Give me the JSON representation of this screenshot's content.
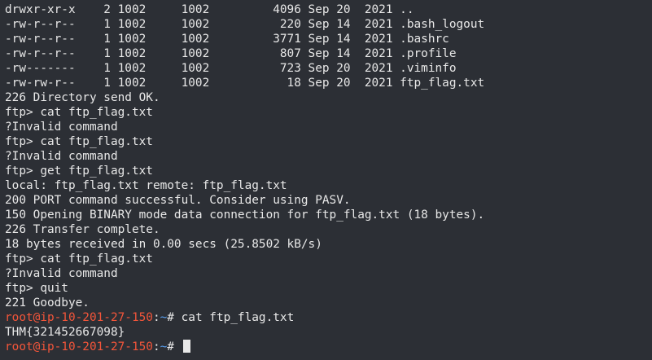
{
  "terminal": {
    "listing": [
      "drwxr-xr-x    2 1002     1002         4096 Sep 20  2021 ..",
      "-rw-r--r--    1 1002     1002          220 Sep 14  2021 .bash_logout",
      "-rw-r--r--    1 1002     1002         3771 Sep 14  2021 .bashrc",
      "-rw-r--r--    1 1002     1002          807 Sep 14  2021 .profile",
      "-rw-------    1 1002     1002          723 Sep 20  2021 .viminfo",
      "-rw-rw-r--    1 1002     1002           18 Sep 20  2021 ftp_flag.txt"
    ],
    "output": [
      "226 Directory send OK.",
      "ftp> cat ftp_flag.txt",
      "?Invalid command",
      "ftp> cat ftp_flag.txt",
      "?Invalid command",
      "ftp> get ftp_flag.txt",
      "local: ftp_flag.txt remote: ftp_flag.txt",
      "200 PORT command successful. Consider using PASV.",
      "150 Opening BINARY mode data connection for ftp_flag.txt (18 bytes).",
      "226 Transfer complete.",
      "18 bytes received in 0.00 secs (25.8502 kB/s)",
      "ftp> cat ftp_flag.txt",
      "?Invalid command",
      "ftp> quit",
      "221 Goodbye."
    ],
    "prompt_user": "root@ip-10-201-27-150",
    "prompt_sep": ":",
    "prompt_path": "~",
    "prompt_symbol": "# ",
    "command": "cat ftp_flag.txt",
    "flag_output": "THM{321452667098}"
  }
}
